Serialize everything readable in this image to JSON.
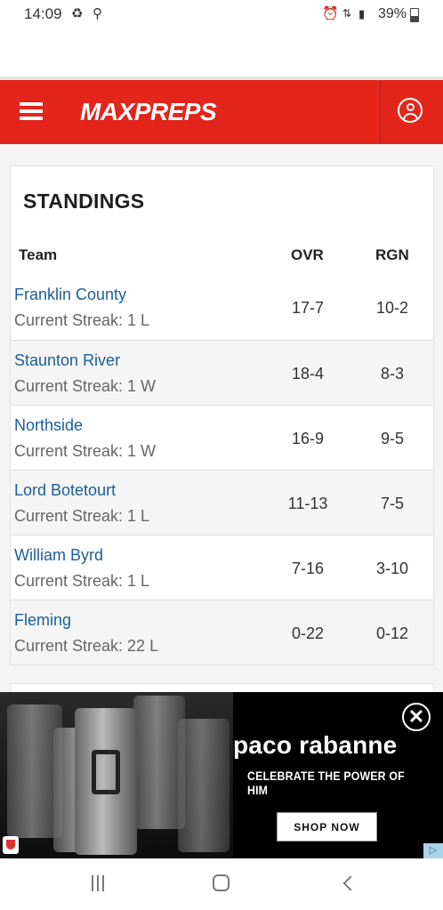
{
  "status_bar": {
    "time": "14:09",
    "battery": "39%"
  },
  "header": {
    "logo_text": "MAXPREPS"
  },
  "standings": {
    "title": "STANDINGS",
    "columns": {
      "team": "Team",
      "ovr": "OVR",
      "rgn": "RGN"
    },
    "rows": [
      {
        "team": "Franklin County",
        "streak": "Current Streak: 1 L",
        "ovr": "17-7",
        "rgn": "10-2"
      },
      {
        "team": "Staunton River",
        "streak": "Current Streak: 1 W",
        "ovr": "18-4",
        "rgn": "8-3"
      },
      {
        "team": "Northside",
        "streak": "Current Streak: 1 W",
        "ovr": "16-9",
        "rgn": "9-5"
      },
      {
        "team": "Lord Botetourt",
        "streak": "Current Streak: 1 L",
        "ovr": "11-13",
        "rgn": "7-5"
      },
      {
        "team": "William Byrd",
        "streak": "Current Streak: 1 L",
        "ovr": "7-16",
        "rgn": "3-10"
      },
      {
        "team": "Fleming",
        "streak": "Current Streak: 22 L",
        "ovr": "0-22",
        "rgn": "0-12"
      }
    ]
  },
  "ad": {
    "brand": "paco rabanne",
    "tagline": "CELEBRATE THE POWER OF HIM",
    "cta": "SHOP NOW",
    "close_symbol": "✕",
    "adchoices_symbol": "▷"
  },
  "icons": {
    "menu": "hamburger-icon",
    "user": "user-account-icon",
    "alarm": "alarm-icon",
    "location": "location-icon",
    "signal": "signal-icon"
  }
}
